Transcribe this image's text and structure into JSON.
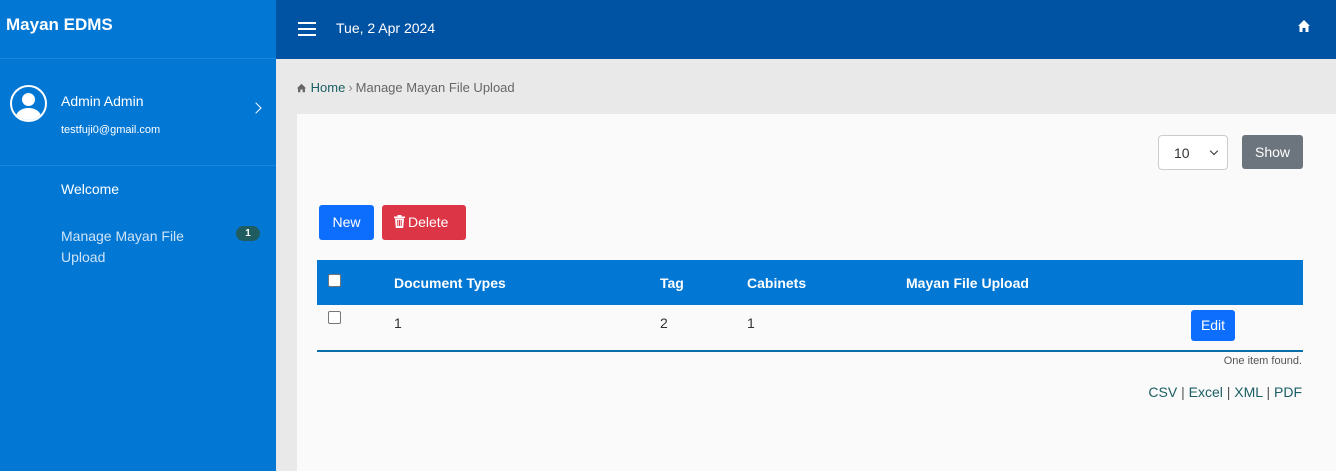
{
  "app": {
    "title": "Mayan EDMS"
  },
  "user": {
    "name": "Admin Admin",
    "email": "testfuji0@gmail.com"
  },
  "sidebar": {
    "items": [
      {
        "label": "Welcome"
      },
      {
        "label": "Manage Mayan File Upload",
        "badge": "1"
      }
    ]
  },
  "header": {
    "date": "Tue, 2 Apr 2024",
    "icons": [
      "menu-icon",
      "home-icon"
    ]
  },
  "breadcrumb": {
    "home": "Home",
    "current": "Manage Mayan File Upload"
  },
  "toolbar": {
    "per_page": "10",
    "show_label": "Show",
    "new_label": "New",
    "delete_label": "Delete"
  },
  "table": {
    "columns": [
      "Document Types",
      "Tag",
      "Cabinets",
      "Mayan File Upload"
    ],
    "rows": [
      {
        "document_types": "1",
        "tag": "2",
        "cabinets": "1",
        "mayan_file_upload": "",
        "action": "Edit"
      }
    ],
    "summary": "One item found."
  },
  "exports": [
    "CSV",
    "Excel",
    "XML",
    "PDF"
  ],
  "colors": {
    "sidebar": "#0277d4",
    "topbar": "#0052a3",
    "primary": "#0d6efd",
    "danger": "#dc3545",
    "secondary": "#6c757d"
  }
}
